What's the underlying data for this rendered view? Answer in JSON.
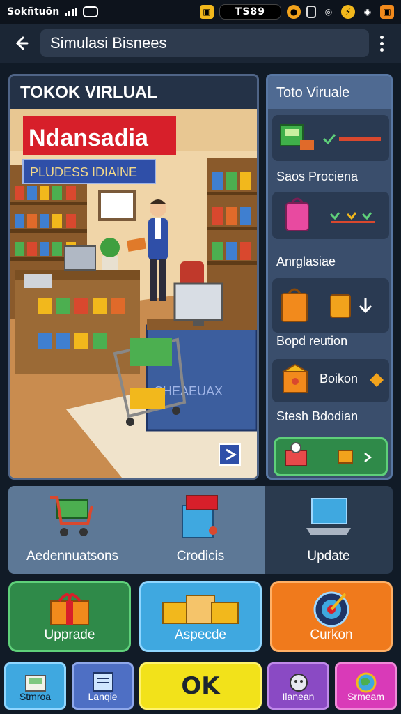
{
  "status_bar": {
    "carrier": "Sokñtuön",
    "time": "TS89",
    "icons": [
      "signal-icon",
      "camera-icon",
      "notification-icon",
      "coin-icon",
      "sim-icon",
      "wifi-icon",
      "bolt-icon",
      "target-icon",
      "battery-icon"
    ]
  },
  "header": {
    "title": "Simulasi Bisnees"
  },
  "scene": {
    "title": "TOKOK VIRLUAL",
    "banner_red": "Ndansadia",
    "banner_blue": "PLUDESS IDIAINE",
    "counter_text": "CHEAEUAX",
    "colors": {
      "banner_red": "#d71f2a",
      "banner_blue": "#2f4fa8"
    }
  },
  "side_panel": {
    "title": "Toto Viruale",
    "items": [
      {
        "label": "Saos Prociena",
        "icon": "register-icon"
      },
      {
        "label": "Anrglasiae",
        "icon": "pink-bag-icon"
      },
      {
        "label": "Bopd reution",
        "icon": "orange-bags-icon"
      },
      {
        "label": "Stesh Bdodian",
        "icon": "box-icon",
        "badge": "Boikon"
      }
    ],
    "go_icon": "arrow-right-icon"
  },
  "tiles": [
    {
      "label": "Aedennuatsons",
      "icon": "shopping-cart-icon"
    },
    {
      "label": "Crodicis",
      "icon": "cash-register-icon"
    },
    {
      "label": "Update",
      "icon": "laptop-icon"
    }
  ],
  "buttons": [
    {
      "label": "Upprade",
      "icon": "gift-box-icon",
      "color": "#2f8a49"
    },
    {
      "label": "Aspecde",
      "icon": "package-icon",
      "color": "#3fa8e0"
    },
    {
      "label": "Curkon",
      "icon": "target-icon",
      "color": "#f07a1c"
    }
  ],
  "bottom_nav": {
    "left": [
      {
        "label": "Stmroa",
        "icon": "store-icon"
      },
      {
        "label": "Lanqie",
        "icon": "document-icon"
      }
    ],
    "ok_label": "OK",
    "right": [
      {
        "label": "Ilanean",
        "icon": "mascot-icon"
      },
      {
        "label": "Srmeam",
        "icon": "globe-icon"
      }
    ]
  }
}
